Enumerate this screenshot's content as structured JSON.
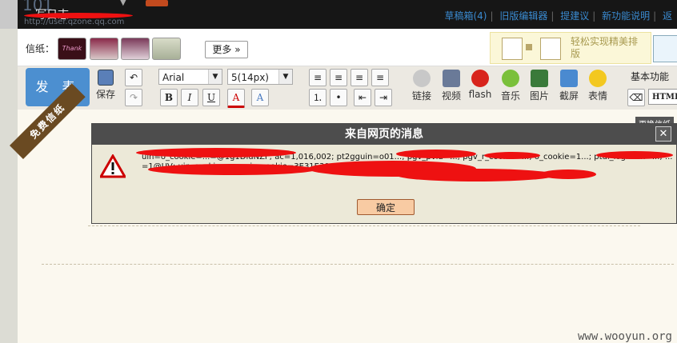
{
  "topbar": {
    "title": "写日志",
    "num": "101",
    "sub_url": "http://user.qzone.qq.com",
    "links": [
      "草稿箱(4)",
      "旧版编辑器",
      "提建议",
      "新功能说明",
      "返"
    ]
  },
  "stationery": {
    "label": "信纸：",
    "more_label": "更多",
    "thumb1_text": "Thank You",
    "promo_text": "轻松实现精美排版"
  },
  "toolbar": {
    "publish_label": "发 表",
    "save_label": "保存",
    "font_family": "Arial",
    "font_size": "5(14px)",
    "bold": "B",
    "italic": "I",
    "underline": "U",
    "font_color": "A",
    "font_bg": "A",
    "link_label": "链接",
    "video_label": "视频",
    "flash_label": "flash",
    "music_label": "音乐",
    "picture_label": "图片",
    "screenshot_label": "截屏",
    "emoji_label": "表情",
    "basic_label": "基本功能",
    "html_label": "HTML"
  },
  "editor": {
    "free_badge": "免费信纸",
    "change_paper": "更换信纸"
  },
  "dialog": {
    "title": "来自网页的消息",
    "close": "✕",
    "message": "uin=o_cookie=...=@1g1DluNZF; ac=1,016,002; pt2gguin=o01...; pgv_pvid=...; pgv_r_cookie=...; o_cookie=1...; ptui_loginuin=...; ...=1@UV; uin_cookie=...; euin_cookie=3E31E30A5FAC...; p_skey=...; ssid=...",
    "ok_label": "确定"
  },
  "watermark": "www.wooyun.org",
  "colors": {
    "accent": "#4c8fd0",
    "redaction": "#ee1111",
    "dialog_title_bg": "#4d4d4d",
    "ok_bg": "#f8cba3"
  },
  "icons": [
    "undo-icon",
    "redo-icon",
    "save-icon",
    "warning-icon",
    "link-icon",
    "video-icon",
    "flash-icon",
    "music-icon",
    "picture-icon",
    "screenshot-icon",
    "emoji-icon"
  ]
}
